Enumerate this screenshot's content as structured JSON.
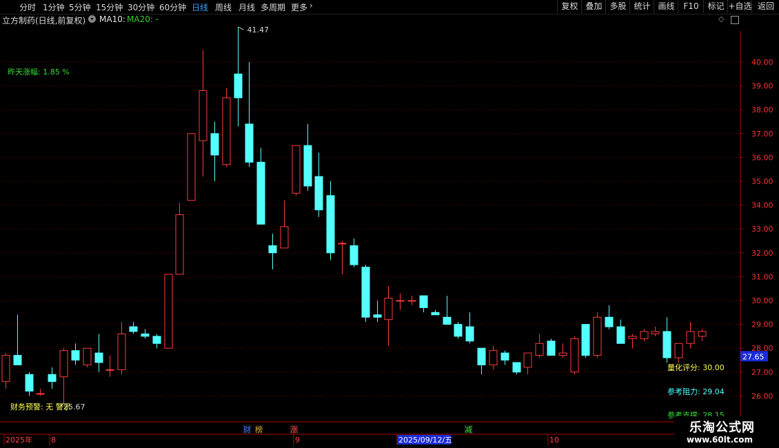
{
  "toolbar": {
    "periods": [
      "分时",
      "1分钟",
      "5分钟",
      "15分钟",
      "30分钟",
      "60分钟",
      "日线",
      "周线",
      "月线",
      "多周期",
      "更多"
    ],
    "active_period": "日线",
    "right_buttons": [
      "复权",
      "叠加",
      "多股",
      "统计",
      "画线",
      "F10",
      "标记",
      "+自选",
      "返回"
    ]
  },
  "title": {
    "stock": "立方制药(日线,前复权)",
    "ma10": "MA10:",
    "ma20": "MA20: -"
  },
  "indicators": {
    "yesterday_change": "昨天涨幅: 1.85 %",
    "quant_score": "量化评分: 30.00",
    "ref_resistance": "参考阻力: 29.04",
    "ref_support": "参考支撑: 28.15",
    "finance_warning": "财务预警: 无 警示",
    "low_label": "25.67",
    "high_label": "41.47",
    "current_price": "27.65"
  },
  "axis": {
    "y_ticks": [
      "40.00",
      "39.00",
      "38.00",
      "37.00",
      "36.00",
      "35.00",
      "34.00",
      "33.00",
      "32.00",
      "31.00",
      "30.00",
      "29.00",
      "28.00",
      "27.00",
      "26.00"
    ],
    "date_labels": [
      "2025年",
      "8",
      "9",
      "2025/09/12/五",
      "10"
    ],
    "event_markers": [
      "财",
      "榜",
      "涨",
      "减"
    ]
  },
  "colors": {
    "up": "#ff3b3b",
    "down": "#54ffff",
    "grid": "#7a0000",
    "axis": "#b00000",
    "active_tab": "#3ea0ff"
  },
  "brand": {
    "name": "乐淘公式网",
    "url": "www.60lt.com"
  },
  "chart_data": {
    "type": "candlestick",
    "ylim": [
      25.4,
      41.9
    ],
    "candles": [
      {
        "o": 26.6,
        "h": 27.8,
        "l": 26.3,
        "c": 27.7
      },
      {
        "o": 27.7,
        "h": 29.4,
        "l": 27.3,
        "c": 27.3
      },
      {
        "o": 26.9,
        "h": 27.0,
        "l": 26.0,
        "c": 26.2
      },
      {
        "o": 26.1,
        "h": 26.3,
        "l": 26.0,
        "c": 26.1
      },
      {
        "o": 26.9,
        "h": 27.2,
        "l": 26.3,
        "c": 26.6
      },
      {
        "o": 26.8,
        "h": 28.0,
        "l": 25.7,
        "c": 27.9
      },
      {
        "o": 27.9,
        "h": 28.2,
        "l": 27.3,
        "c": 27.5
      },
      {
        "o": 27.3,
        "h": 28.0,
        "l": 27.2,
        "c": 28.0
      },
      {
        "o": 27.8,
        "h": 28.6,
        "l": 27.0,
        "c": 27.4
      },
      {
        "o": 27.1,
        "h": 27.7,
        "l": 26.8,
        "c": 27.1
      },
      {
        "o": 27.1,
        "h": 29.1,
        "l": 26.9,
        "c": 28.6
      },
      {
        "o": 28.9,
        "h": 29.1,
        "l": 28.6,
        "c": 28.7
      },
      {
        "o": 28.6,
        "h": 28.8,
        "l": 28.4,
        "c": 28.5
      },
      {
        "o": 28.5,
        "h": 28.6,
        "l": 28.0,
        "c": 28.2
      },
      {
        "o": 28.0,
        "h": 31.1,
        "l": 28.0,
        "c": 31.1
      },
      {
        "o": 31.1,
        "h": 34.1,
        "l": 31.1,
        "c": 33.6
      },
      {
        "o": 34.2,
        "h": 37.0,
        "l": 34.2,
        "c": 37.0
      },
      {
        "o": 36.7,
        "h": 40.5,
        "l": 35.2,
        "c": 38.8
      },
      {
        "o": 37.0,
        "h": 37.5,
        "l": 35.0,
        "c": 36.1
      },
      {
        "o": 35.7,
        "h": 38.9,
        "l": 35.6,
        "c": 38.5
      },
      {
        "o": 39.5,
        "h": 41.47,
        "l": 37.3,
        "c": 38.5
      },
      {
        "o": 37.4,
        "h": 40.0,
        "l": 35.6,
        "c": 35.8
      },
      {
        "o": 35.8,
        "h": 36.4,
        "l": 33.2,
        "c": 33.2
      },
      {
        "o": 32.3,
        "h": 32.8,
        "l": 31.3,
        "c": 32.0
      },
      {
        "o": 32.2,
        "h": 34.2,
        "l": 32.2,
        "c": 33.1
      },
      {
        "o": 34.5,
        "h": 36.0,
        "l": 34.4,
        "c": 36.5
      },
      {
        "o": 36.5,
        "h": 37.4,
        "l": 34.6,
        "c": 34.8
      },
      {
        "o": 35.2,
        "h": 36.2,
        "l": 33.5,
        "c": 33.8
      },
      {
        "o": 34.4,
        "h": 35.0,
        "l": 31.7,
        "c": 32.0
      },
      {
        "o": 32.4,
        "h": 32.5,
        "l": 31.1,
        "c": 32.4
      },
      {
        "o": 32.3,
        "h": 32.6,
        "l": 31.4,
        "c": 31.5
      },
      {
        "o": 31.4,
        "h": 31.5,
        "l": 29.1,
        "c": 29.3
      },
      {
        "o": 29.4,
        "h": 30.0,
        "l": 29.1,
        "c": 29.3
      },
      {
        "o": 29.2,
        "h": 30.6,
        "l": 28.1,
        "c": 30.1
      },
      {
        "o": 30.0,
        "h": 30.3,
        "l": 29.6,
        "c": 30.0
      },
      {
        "o": 30.0,
        "h": 30.2,
        "l": 29.8,
        "c": 30.0
      },
      {
        "o": 30.2,
        "h": 30.2,
        "l": 29.5,
        "c": 29.7
      },
      {
        "o": 29.5,
        "h": 29.6,
        "l": 29.4,
        "c": 29.4
      },
      {
        "o": 29.3,
        "h": 30.2,
        "l": 29.0,
        "c": 29.0
      },
      {
        "o": 29.0,
        "h": 29.1,
        "l": 28.4,
        "c": 28.5
      },
      {
        "o": 28.9,
        "h": 29.5,
        "l": 28.2,
        "c": 28.3
      },
      {
        "o": 28.0,
        "h": 28.0,
        "l": 26.9,
        "c": 27.3
      },
      {
        "o": 27.3,
        "h": 28.1,
        "l": 27.1,
        "c": 27.9
      },
      {
        "o": 27.8,
        "h": 27.9,
        "l": 27.3,
        "c": 27.5
      },
      {
        "o": 27.4,
        "h": 27.4,
        "l": 26.9,
        "c": 27.0
      },
      {
        "o": 27.2,
        "h": 27.8,
        "l": 26.9,
        "c": 27.8
      },
      {
        "o": 27.7,
        "h": 28.6,
        "l": 27.6,
        "c": 28.2
      },
      {
        "o": 28.3,
        "h": 28.4,
        "l": 27.7,
        "c": 27.7
      },
      {
        "o": 27.7,
        "h": 28.2,
        "l": 27.6,
        "c": 27.8
      },
      {
        "o": 27.0,
        "h": 28.5,
        "l": 26.9,
        "c": 28.4
      },
      {
        "o": 29.0,
        "h": 29.0,
        "l": 27.6,
        "c": 27.7
      },
      {
        "o": 27.7,
        "h": 29.5,
        "l": 27.6,
        "c": 29.3
      },
      {
        "o": 29.3,
        "h": 29.8,
        "l": 28.8,
        "c": 28.9
      },
      {
        "o": 28.9,
        "h": 29.2,
        "l": 28.2,
        "c": 28.2
      },
      {
        "o": 28.4,
        "h": 28.6,
        "l": 28.0,
        "c": 28.5
      },
      {
        "o": 28.4,
        "h": 28.8,
        "l": 28.3,
        "c": 28.7
      },
      {
        "o": 28.6,
        "h": 28.9,
        "l": 28.5,
        "c": 28.7
      },
      {
        "o": 28.7,
        "h": 29.3,
        "l": 27.4,
        "c": 27.6
      },
      {
        "o": 27.6,
        "h": 28.2,
        "l": 27.4,
        "c": 28.2
      },
      {
        "o": 28.2,
        "h": 29.1,
        "l": 28.0,
        "c": 28.7
      },
      {
        "o": 28.5,
        "h": 28.8,
        "l": 28.3,
        "c": 28.7
      }
    ]
  }
}
